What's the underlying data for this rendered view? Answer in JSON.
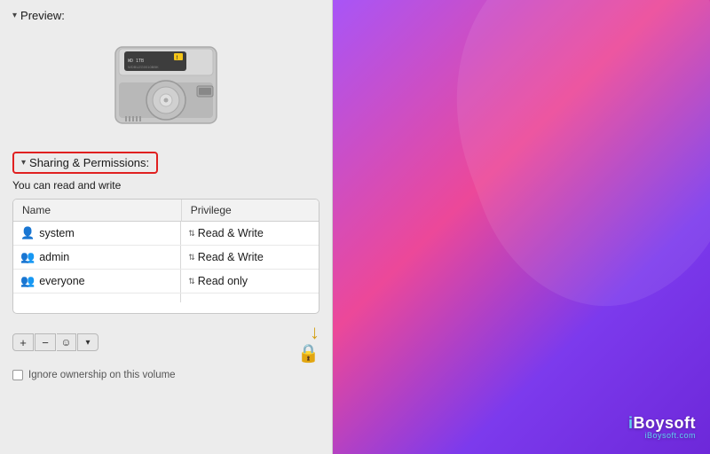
{
  "preview": {
    "header": "Preview:",
    "chevron": "▾"
  },
  "sharing": {
    "header": "Sharing & Permissions:",
    "chevron": "▾",
    "subtitle": "You can read and write"
  },
  "table": {
    "col_name": "Name",
    "col_privilege": "Privilege",
    "rows": [
      {
        "icon": "system-icon",
        "icon_glyph": "👤",
        "name": "system",
        "privilege": "Read & Write"
      },
      {
        "icon": "admin-icon",
        "icon_glyph": "👥",
        "name": "admin",
        "privilege": "Read & Write"
      },
      {
        "icon": "everyone-icon",
        "icon_glyph": "👥",
        "name": "everyone",
        "privilege": "Read only"
      }
    ]
  },
  "controls": {
    "add": "+",
    "remove": "−",
    "action": "☺",
    "dropdown": "▾"
  },
  "ignore_ownership": {
    "label": "Ignore ownership on this volume"
  },
  "watermark": {
    "brand": "iBoysoft",
    "domain": "iBoysoft.com"
  }
}
